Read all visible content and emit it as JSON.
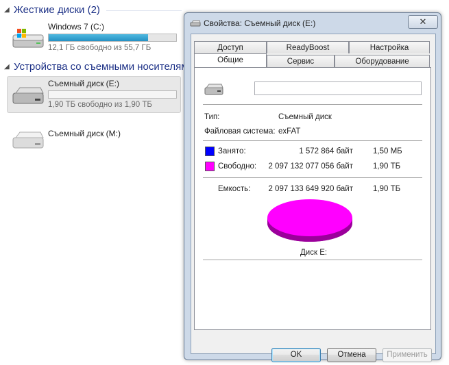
{
  "explorer": {
    "hard_disks_header": "Жесткие диски (2)",
    "removable_header": "Устройства со съемными носителям",
    "drives": [
      {
        "name": "Windows 7 (C:)",
        "free_text": "12,1 ГБ свободно из 55,7 ГБ",
        "used_fraction": 0.78,
        "icon": "windows-hdd-icon"
      },
      {
        "name": "Съемный диск (E:)",
        "free_text": "1,90 ТБ свободно из 1,90 ТБ",
        "used_fraction": 0.0,
        "icon": "removable-drive-icon"
      },
      {
        "name": "Съемный диск (M:)",
        "icon": "removable-drive-icon"
      }
    ]
  },
  "dialog": {
    "title": "Свойства: Съемный диск (E:)",
    "close_glyph": "✕",
    "tabs_row1": [
      "Доступ",
      "ReadyBoost",
      "Настройка"
    ],
    "tabs_row2": [
      "Общие",
      "Сервис",
      "Оборудование"
    ],
    "active_tab": "Общие",
    "volume_label_value": "",
    "type_label": "Тип:",
    "type_value": "Съемный диск",
    "fs_label": "Файловая система:",
    "fs_value": "exFAT",
    "used": {
      "label": "Занято:",
      "bytes": "1 572 864 байт",
      "size": "1,50 МБ",
      "color": "#0000ff"
    },
    "free": {
      "label": "Свободно:",
      "bytes": "2 097 132 077 056 байт",
      "size": "1,90 ТБ",
      "color": "#ff00ff"
    },
    "capacity": {
      "label": "Емкость:",
      "bytes": "2 097 133 649 920 байт",
      "size": "1,90 ТБ"
    },
    "disk_label": "Диск E:",
    "buttons": {
      "ok": "OK",
      "cancel": "Отмена",
      "apply": "Применить"
    }
  },
  "chart_data": {
    "type": "pie",
    "categories": [
      "Занято",
      "Свободно"
    ],
    "values": [
      1572864,
      2097132077056
    ],
    "colors": [
      "#0000ff",
      "#ff00ff"
    ]
  }
}
